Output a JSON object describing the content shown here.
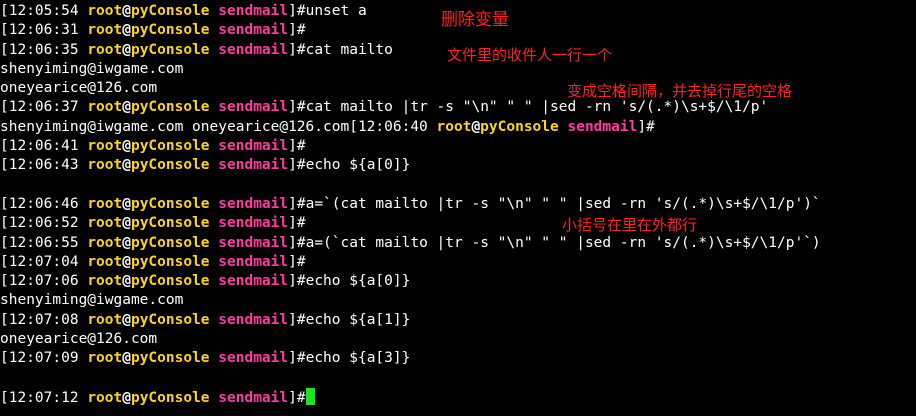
{
  "prompt": {
    "user": "root",
    "at": "@",
    "host": "pyConsole",
    "dir": "sendmail",
    "hash": "]#"
  },
  "lines": [
    {
      "kind": "prompt",
      "time": "12:05:54",
      "cmd": "unset a"
    },
    {
      "kind": "prompt",
      "time": "12:06:31",
      "cmd": ""
    },
    {
      "kind": "prompt",
      "time": "12:06:35",
      "cmd": "cat mailto"
    },
    {
      "kind": "output",
      "text": "shenyiming@iwgame.com"
    },
    {
      "kind": "output",
      "text": "oneyearice@126.com"
    },
    {
      "kind": "prompt",
      "time": "12:06:37",
      "cmd": "cat mailto |tr -s \"\\n\" \" \" |sed -rn 's/(.*)\\s+$/\\1/p'"
    },
    {
      "kind": "mixed",
      "text": "shenyiming@iwgame.com oneyearice@126.com",
      "time": "12:06:40",
      "cmd": ""
    },
    {
      "kind": "prompt",
      "time": "12:06:41",
      "cmd": ""
    },
    {
      "kind": "prompt",
      "time": "12:06:43",
      "cmd": "echo ${a[0]}"
    },
    {
      "kind": "blank"
    },
    {
      "kind": "prompt",
      "time": "12:06:46",
      "cmd": "a=`(cat mailto |tr -s \"\\n\" \" \" |sed -rn 's/(.*)\\s+$/\\1/p')`"
    },
    {
      "kind": "prompt",
      "time": "12:06:52",
      "cmd": ""
    },
    {
      "kind": "prompt",
      "time": "12:06:55",
      "cmd": "a=(`cat mailto |tr -s \"\\n\" \" \" |sed -rn 's/(.*)\\s+$/\\1/p'`)"
    },
    {
      "kind": "prompt",
      "time": "12:07:04",
      "cmd": ""
    },
    {
      "kind": "prompt",
      "time": "12:07:06",
      "cmd": "echo ${a[0]}"
    },
    {
      "kind": "output",
      "text": "shenyiming@iwgame.com"
    },
    {
      "kind": "prompt",
      "time": "12:07:08",
      "cmd": "echo ${a[1]}"
    },
    {
      "kind": "output",
      "text": "oneyearice@126.com"
    },
    {
      "kind": "prompt",
      "time": "12:07:09",
      "cmd": "echo ${a[3]}"
    },
    {
      "kind": "blank"
    },
    {
      "kind": "prompt",
      "time": "12:07:12",
      "cmd": "",
      "cursor": true
    }
  ],
  "annotations": {
    "a1": "删除变量",
    "a2": "文件里的收件人一行一个",
    "a3": "变成空格间隔，并去掉行尾的空格",
    "a4": "小括号在里在外都行"
  },
  "colors": {
    "background": "#000000",
    "text": "#ffffff",
    "prompt_user_host": "#ffd21f",
    "prompt_dir": "#ff3aa0",
    "cursor": "#19e619",
    "annotation": "#ff2020"
  }
}
